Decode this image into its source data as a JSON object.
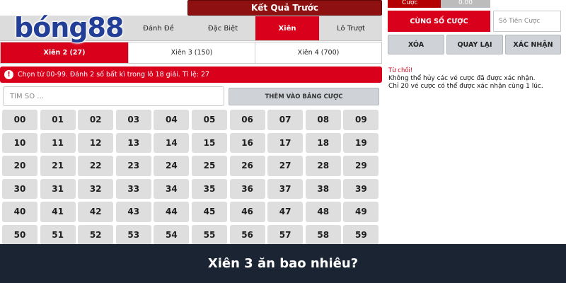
{
  "header": {
    "result_button": "Kết Quả Trước",
    "logo_text": "bóng88",
    "category_tabs": [
      {
        "label": "Đánh Đề"
      },
      {
        "label": "Đặc Biệt"
      },
      {
        "label": "Xiên",
        "active": true
      },
      {
        "label": "Lô Trượt"
      }
    ]
  },
  "sub_tabs": [
    {
      "label": "Xiên 2 (27)",
      "active": true
    },
    {
      "label": "Xiên 3 (150)"
    },
    {
      "label": "Xiên 4 (700)"
    }
  ],
  "info": {
    "icon": "info-icon",
    "text": "Chọn từ 00-99. Đánh 2 số bất kì trong lô 18 giải. Tỉ lệ: 27"
  },
  "search": {
    "placeholder": "TÌM SỐ ...",
    "value": ""
  },
  "add_button": "THÊM VÀO BẢNG CƯỢC",
  "numbers": [
    "00",
    "01",
    "02",
    "03",
    "04",
    "05",
    "06",
    "07",
    "08",
    "09",
    "10",
    "11",
    "12",
    "13",
    "14",
    "15",
    "16",
    "17",
    "18",
    "19",
    "20",
    "21",
    "22",
    "23",
    "24",
    "25",
    "26",
    "27",
    "28",
    "29",
    "30",
    "31",
    "32",
    "33",
    "34",
    "35",
    "36",
    "37",
    "38",
    "39",
    "40",
    "41",
    "42",
    "43",
    "44",
    "45",
    "46",
    "47",
    "48",
    "49",
    "50",
    "51",
    "52",
    "53",
    "54",
    "55",
    "56",
    "57",
    "58",
    "59"
  ],
  "right_panel": {
    "top_partial_left": "Cược",
    "top_partial_right": "0.00",
    "same_bet_button": "CÙNG SỐ CƯỢC",
    "amount_placeholder": "Số Tiền Cược",
    "actions": [
      "XÓA",
      "QUAY LẠI",
      "XÁC NHẬN"
    ],
    "reject_title": "Từ chối!",
    "reject_lines": [
      "Không thể hủy các vé cược đã được xác nhận.",
      "Chỉ 20 vé cược có thể được xác nhận cùng 1 lúc."
    ]
  },
  "footer": {
    "caption": "Xiên 3 ăn bao nhiêu?"
  },
  "colors": {
    "accent_red": "#d9001b",
    "dark_red": "#8e1010",
    "logo_blue": "#223e96",
    "footer_bg": "#1b2433",
    "button_grey": "#cfd3d8",
    "cell_grey": "#dedede"
  }
}
